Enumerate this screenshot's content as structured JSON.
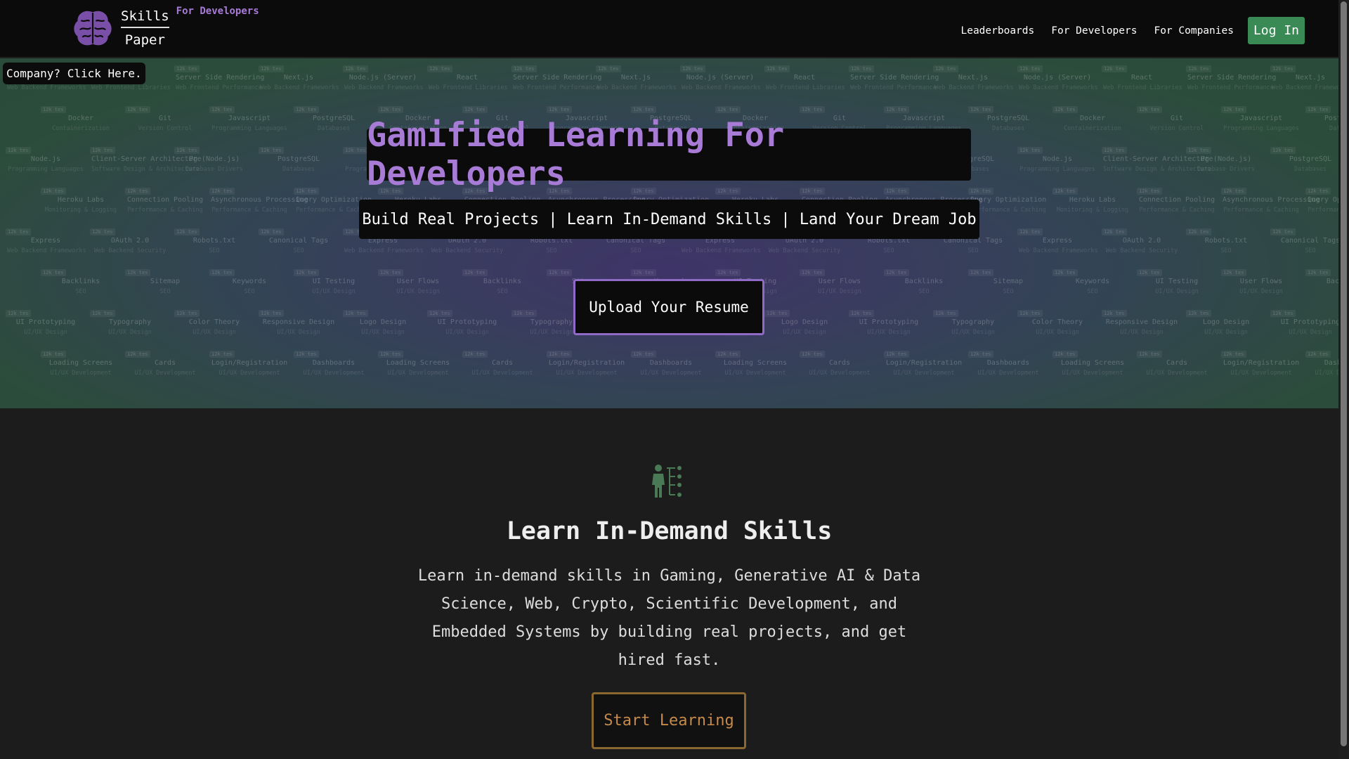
{
  "nav": {
    "brand_top": "Skills",
    "brand_bottom": "Paper",
    "brand_tag": "For Developers",
    "links": [
      "Leaderboards",
      "For Developers",
      "For Companies"
    ],
    "login": "Log In"
  },
  "hero": {
    "company_cta": "Company? Click Here.",
    "title": "Gamified Learning For Developers",
    "subtitle": "Build Real Projects | Learn In-Demand Skills | Land Your Dream Job",
    "upload": "Upload Your Resume",
    "badge_text": "12k tes",
    "tiles": [
      [
        [
          "Node.js (Server)",
          "Web Backend Frameworks"
        ],
        [
          "React",
          "Web Frontend Libraries"
        ],
        [
          "Server Side Rendering",
          "Web Frontend Performance"
        ],
        [
          "Next.js",
          "Web Backend Frameworks"
        ]
      ],
      [
        [
          "Docker",
          "Containerization"
        ],
        [
          "Git",
          "Version Control"
        ],
        [
          "Javascript",
          "Programming Languages"
        ],
        [
          "PostgreSQL",
          "Databases"
        ]
      ],
      [
        [
          "Node.js",
          "Programming Languages"
        ],
        [
          "Client-Server Architecture",
          "Software Design & Architecture"
        ],
        [
          "Pg (Node.js)",
          "Database Drivers"
        ],
        [
          "PostgreSQL",
          "Databases"
        ]
      ],
      [
        [
          "Heroku Labs",
          "Monitoring & Logging"
        ],
        [
          "Connection Pooling",
          "Performance & Caching"
        ],
        [
          "Asynchronous Processing",
          "Performance & Caching"
        ],
        [
          "Query Optimization",
          "Performance & Caching"
        ]
      ],
      [
        [
          "Express",
          "Web Backend Frameworks"
        ],
        [
          "OAuth 2.0",
          "Web Backend Security"
        ],
        [
          "Robots.txt",
          "SEO"
        ],
        [
          "Canonical Tags",
          "SEO"
        ]
      ],
      [
        [
          "Backlinks",
          "SEO"
        ],
        [
          "Sitemap",
          "SEO"
        ],
        [
          "Keywords",
          "SEO"
        ],
        [
          "UI Testing",
          "UI/UX Design"
        ],
        [
          "User Flows",
          "UI/UX Design"
        ]
      ],
      [
        [
          "UI Prototyping",
          "UI/UX Design"
        ],
        [
          "Typography",
          "UI/UX Design"
        ],
        [
          "Color Theory",
          "UI/UX Design"
        ],
        [
          "Responsive Design",
          "UI/UX Design"
        ],
        [
          "Logo Design",
          "UI/UX Design"
        ]
      ],
      [
        [
          "Loading Screens",
          "UI/UX Development"
        ],
        [
          "Cards",
          "UI/UX Development"
        ],
        [
          "Login/Registration",
          "UI/UX Development"
        ],
        [
          "Dashboards",
          "UI/UX Development"
        ]
      ]
    ]
  },
  "section": {
    "title": "Learn In-Demand Skills",
    "description": "Learn in-demand skills in Gaming, Generative AI & Data Science, Web, Crypto, Scientific Development, and Embedded Systems by building real projects, and get hired fast.",
    "cta": "Start Learning"
  },
  "colors": {
    "accent_purple": "#a77bd6",
    "login_green": "#3a8a55",
    "icon_green": "#4a7a55",
    "start_orange": "#c68a4a"
  }
}
